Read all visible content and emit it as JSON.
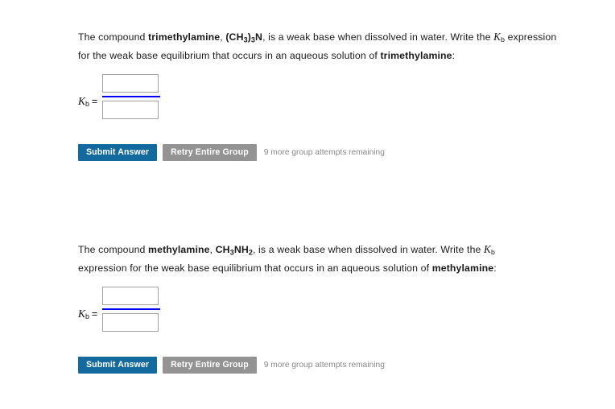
{
  "page": {
    "background_color": "#ffffff",
    "accent_blue": "#136a9f",
    "fraction_bar_color": "#0000ff",
    "retry_gray": "#939393",
    "attempts_text_color": "#8a8a8a"
  },
  "groups": [
    {
      "id": "group-1",
      "prompt": {
        "lead": "The compound ",
        "compound_name": "trimethylamine",
        "comma": ", ",
        "formula_parts": [
          {
            "text": "(CH",
            "sub": false
          },
          {
            "text": "3",
            "sub": true
          },
          {
            "text": ")",
            "sub": false
          },
          {
            "text": "3",
            "sub": true
          },
          {
            "text": "N",
            "sub": false
          }
        ],
        "formula_plain": "(CH3)3N",
        "middle": ", is a weak base when dissolved in water. Write the ",
        "k_symbol": "K",
        "k_subscript": "b",
        "after_k": " expression for the weak base equilibrium that occurs in an aqueous solution of ",
        "compound_name_2": "trimethylamine",
        "colon": ":"
      },
      "answer": {
        "label_k": "K",
        "label_sub": "b",
        "label_equals": "=",
        "numerator_value": "",
        "numerator_placeholder": "",
        "denominator_value": "",
        "denominator_placeholder": ""
      },
      "buttons": {
        "submit_label": "Submit Answer",
        "retry_label": "Retry Entire Group",
        "attempts_text": "9 more group attempts remaining"
      }
    },
    {
      "id": "group-2",
      "prompt": {
        "lead": "The compound ",
        "compound_name": "methylamine",
        "comma": ", ",
        "formula_parts": [
          {
            "text": "CH",
            "sub": false
          },
          {
            "text": "3",
            "sub": true
          },
          {
            "text": "NH",
            "sub": false
          },
          {
            "text": "2",
            "sub": true
          }
        ],
        "formula_plain": "CH3NH2",
        "middle": ", is a weak base when dissolved in water. Write the ",
        "k_symbol": "K",
        "k_subscript": "b",
        "after_k": " expression for the weak base equilibrium that occurs in an aqueous solution of ",
        "compound_name_2": "methylamine",
        "colon": ":"
      },
      "answer": {
        "label_k": "K",
        "label_sub": "b",
        "label_equals": "=",
        "numerator_value": "",
        "numerator_placeholder": "",
        "denominator_value": "",
        "denominator_placeholder": ""
      },
      "buttons": {
        "submit_label": "Submit Answer",
        "retry_label": "Retry Entire Group",
        "attempts_text": "9 more group attempts remaining"
      }
    }
  ]
}
